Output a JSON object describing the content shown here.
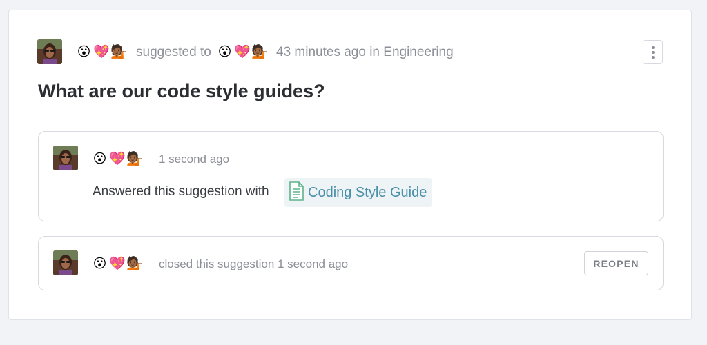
{
  "suggestion": {
    "author_emojis": [
      "😮",
      "💖",
      "💁🏾"
    ],
    "suggested_to_label": "suggested to",
    "recipient_emojis": [
      "😮",
      "💖",
      "💁🏾"
    ],
    "time_and_place": "43 minutes ago in Engineering",
    "title": "What are our code style guides?",
    "menu_icon": "kebab-menu-icon"
  },
  "answer_event": {
    "emojis": [
      "😮",
      "💖",
      "💁🏾"
    ],
    "timestamp": "1 second ago",
    "text": "Answered this suggestion with",
    "document": {
      "icon": "document-icon",
      "title": "Coding Style Guide"
    }
  },
  "close_event": {
    "emojis": [
      "😮",
      "💖",
      "💁🏾"
    ],
    "text": "closed this suggestion 1 second ago",
    "reopen_label": "REOPEN"
  },
  "colors": {
    "background": "#f1f3f6",
    "link": "#4a8fa8",
    "muted_text": "#8c8f97",
    "title_text": "#2b2e33"
  }
}
